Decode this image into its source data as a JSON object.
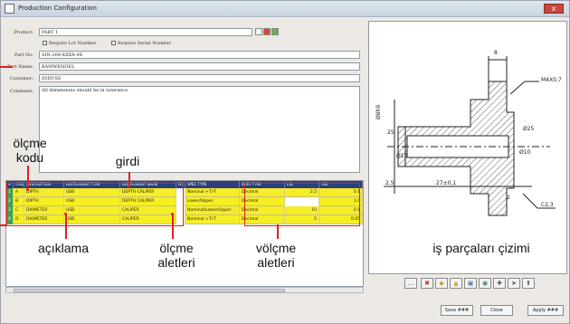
{
  "window": {
    "title": "Production Configuration",
    "close_label": "x"
  },
  "form": {
    "product_label": "Product:",
    "product_value": "PART 1",
    "lot_checkbox_label": "Require Lot Number",
    "serial_checkbox_label": "Require Serial Number",
    "part_label": "Part No:",
    "part_value": "SIN-208-XXXX-4X",
    "part_name_label": "Part Name:",
    "part_name_value": "KAMWENOEL",
    "customer_label": "Customer:",
    "customer_value": "INDUSS",
    "comment_label": "Comment:",
    "comment_value": "All dimensions should be in tolerance"
  },
  "grid": {
    "columns": [
      "#",
      "CODE",
      "DESCRIPTION",
      "INSTRUMENT TYPE",
      "INSTRUMENT NAME",
      "DT",
      "SPEC TYPE",
      "DATA TYPE",
      "LSL",
      "USL"
    ],
    "rows": [
      {
        "num": "1",
        "code": "A",
        "desc": "DIPTH",
        "type": "USB",
        "name": "DEPTH CALIPER",
        "spec": "Nominal +T/-T",
        "data": "Decimal",
        "lsl": "2.5",
        "usl": "0.1"
      },
      {
        "num": "2",
        "code": "B",
        "desc": "DIPTH",
        "type": "USB",
        "name": "DEPTH CALIPER",
        "spec": "Lower/Upper",
        "data": "Decimal",
        "lsl": "",
        "usl": "1.0"
      },
      {
        "num": "3",
        "code": "C",
        "desc": "DIAMETER",
        "type": "USB",
        "name": "CALIPER",
        "spec": "Nominal/Lower/Upper",
        "data": "Decimal",
        "lsl": "10",
        "usl": "0.1"
      },
      {
        "num": "4",
        "code": "D",
        "desc": "DIAMETER",
        "type": "USB",
        "name": "CALIPER",
        "spec": "Nominal +T/-T",
        "data": "Decimal",
        "lsl": "5",
        "usl": "0.05"
      }
    ]
  },
  "drawing": {
    "dims": [
      "M4X0,7",
      "8",
      "25",
      "Ø12",
      "Ø10",
      "27±0,1",
      "2,5",
      "C2,3",
      "Ø8h9",
      "Ø25",
      "2"
    ]
  },
  "toolbar": {
    "icons": [
      "dots-icon",
      "delete-icon",
      "tag-icon",
      "flag-icon",
      "image-icon",
      "zoom-icon",
      "pin-icon",
      "arrow-icon",
      "upload-icon"
    ]
  },
  "buttons": {
    "save": "Save ###",
    "close": "Close",
    "apply": "Apply ###"
  },
  "annotations": {
    "olcme_kodu": "ölçme\nkodu",
    "girdi": "girdi",
    "aciklama": "açıklama",
    "olcme_aletleri": "ölçme\naletleri",
    "volcme_aletleri": "völçme\naletleri",
    "is_parcalari": "iş parçaları çizimi"
  },
  "colors": {
    "row_fill": "#f6ee25",
    "header": "#2d3f7a",
    "annotation": "#e02020"
  }
}
